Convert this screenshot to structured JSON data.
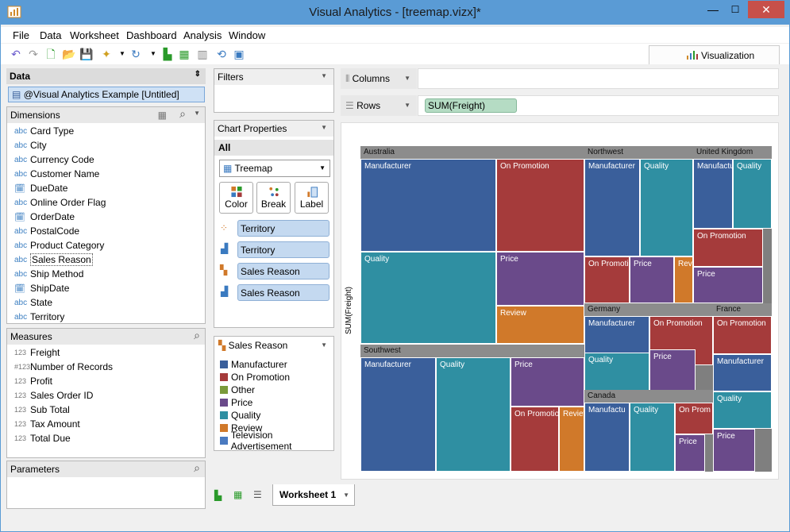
{
  "window": {
    "title": "Visual Analytics - [treemap.vizx]*",
    "min": "—",
    "max": "☐",
    "close": "✕"
  },
  "menu": [
    "File",
    "Data",
    "Worksheet",
    "Dashboard",
    "Analysis",
    "Window"
  ],
  "viz_tab": "Visualization",
  "data_panel": {
    "title": "Data",
    "source": "@Visual Analytics Example [Untitled]"
  },
  "dimensions": {
    "title": "Dimensions",
    "items": [
      {
        "type": "abc",
        "label": "Card Type"
      },
      {
        "type": "abc",
        "label": "City"
      },
      {
        "type": "abc",
        "label": "Currency Code"
      },
      {
        "type": "abc",
        "label": "Customer Name"
      },
      {
        "type": "date",
        "label": "DueDate"
      },
      {
        "type": "abc",
        "label": "Online Order Flag"
      },
      {
        "type": "date",
        "label": "OrderDate"
      },
      {
        "type": "abc",
        "label": "PostalCode"
      },
      {
        "type": "abc",
        "label": "Product Category"
      },
      {
        "type": "abc",
        "label": "Sales Reason"
      },
      {
        "type": "abc",
        "label": "Ship Method"
      },
      {
        "type": "date",
        "label": "ShipDate"
      },
      {
        "type": "abc",
        "label": "State"
      },
      {
        "type": "abc",
        "label": "Territory"
      }
    ]
  },
  "measures": {
    "title": "Measures",
    "items": [
      {
        "type": "123",
        "label": "Freight"
      },
      {
        "type": "#123",
        "label": "Number of Records"
      },
      {
        "type": "123",
        "label": "Profit"
      },
      {
        "type": "123",
        "label": "Sales Order ID"
      },
      {
        "type": "123",
        "label": "Sub Total"
      },
      {
        "type": "123",
        "label": "Tax Amount"
      },
      {
        "type": "123",
        "label": "Total Due"
      }
    ]
  },
  "parameters": {
    "title": "Parameters"
  },
  "filters": {
    "title": "Filters"
  },
  "chart_props": {
    "title": "Chart Properties",
    "all": "All",
    "type": "Treemap",
    "buttons": [
      "Color",
      "Break",
      "Label"
    ],
    "pills": [
      "Territory",
      "Territory",
      "Sales Reason",
      "Sales Reason"
    ]
  },
  "legend": {
    "title": "Sales Reason",
    "items": [
      {
        "label": "Manufacturer",
        "color": "#3a5f9b"
      },
      {
        "label": "On Promotion",
        "color": "#a53b3b"
      },
      {
        "label": "Other",
        "color": "#7a9a3a"
      },
      {
        "label": "Price",
        "color": "#6a4a8a"
      },
      {
        "label": "Quality",
        "color": "#2f8fa2"
      },
      {
        "label": "Review",
        "color": "#d0792a"
      },
      {
        "label": "Television  Advertisement",
        "color": "#4a7ac0"
      }
    ]
  },
  "shelves": {
    "columns": "Columns",
    "rows": "Rows",
    "rows_pill": "SUM(Freight)"
  },
  "chart": {
    "ylabel": "SUM(Freight)"
  },
  "sheet_tab": "Worksheet 1",
  "chart_data": {
    "type": "treemap",
    "groups": [
      {
        "name": "Australia",
        "cells": [
          {
            "label": "Manufacturer",
            "color": "#3a5f9b"
          },
          {
            "label": "On Promotion",
            "color": "#a53b3b"
          },
          {
            "label": "Quality",
            "color": "#2f8fa2"
          },
          {
            "label": "Price",
            "color": "#6a4a8a"
          },
          {
            "label": "Review",
            "color": "#d0792a"
          }
        ]
      },
      {
        "name": "Northwest",
        "cells": [
          {
            "label": "Manufacturer",
            "color": "#3a5f9b"
          },
          {
            "label": "Quality",
            "color": "#2f8fa2"
          },
          {
            "label": "On Promotio",
            "color": "#a53b3b"
          },
          {
            "label": "Price",
            "color": "#6a4a8a"
          },
          {
            "label": "Revi",
            "color": "#d0792a"
          }
        ]
      },
      {
        "name": "United Kingdom",
        "cells": [
          {
            "label": "Manufactu",
            "color": "#3a5f9b"
          },
          {
            "label": "Quality",
            "color": "#2f8fa2"
          },
          {
            "label": "On Promotion",
            "color": "#a53b3b"
          },
          {
            "label": "Price",
            "color": "#6a4a8a"
          }
        ]
      },
      {
        "name": "Southwest",
        "cells": [
          {
            "label": "Manufacturer",
            "color": "#3a5f9b"
          },
          {
            "label": "Quality",
            "color": "#2f8fa2"
          },
          {
            "label": "Price",
            "color": "#6a4a8a"
          },
          {
            "label": "On Promotio",
            "color": "#a53b3b"
          },
          {
            "label": "Review",
            "color": "#d0792a"
          }
        ]
      },
      {
        "name": "Germany",
        "cells": [
          {
            "label": "Manufacturer",
            "color": "#3a5f9b"
          },
          {
            "label": "On Promotion",
            "color": "#a53b3b"
          },
          {
            "label": "Quality",
            "color": "#2f8fa2"
          },
          {
            "label": "Price",
            "color": "#6a4a8a"
          }
        ]
      },
      {
        "name": "France",
        "cells": [
          {
            "label": "On Promotion",
            "color": "#a53b3b"
          },
          {
            "label": "Manufacturer",
            "color": "#3a5f9b"
          },
          {
            "label": "Quality",
            "color": "#2f8fa2"
          },
          {
            "label": "Price",
            "color": "#6a4a8a"
          }
        ]
      },
      {
        "name": "Canada",
        "cells": [
          {
            "label": "Manufactu",
            "color": "#3a5f9b"
          },
          {
            "label": "Quality",
            "color": "#2f8fa2"
          },
          {
            "label": "On Prom",
            "color": "#a53b3b"
          },
          {
            "label": "Price",
            "color": "#6a4a8a"
          }
        ]
      }
    ]
  }
}
